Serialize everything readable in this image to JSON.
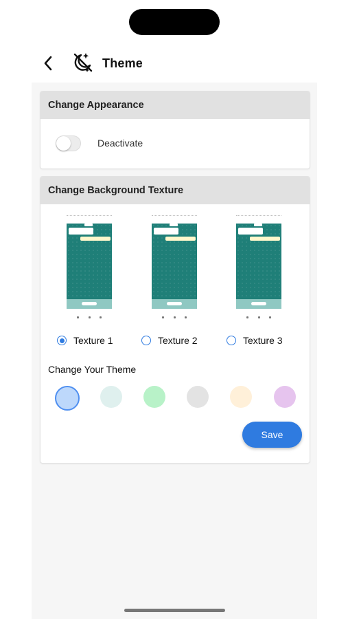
{
  "header": {
    "title": "Theme"
  },
  "appearance": {
    "heading": "Change Appearance",
    "toggle_label": "Deactivate",
    "toggle_on": false
  },
  "background": {
    "heading": "Change Background Texture",
    "textures": [
      {
        "label": "Texture 1",
        "selected": true
      },
      {
        "label": "Texture 2",
        "selected": false
      },
      {
        "label": "Texture 3",
        "selected": false
      }
    ]
  },
  "theme": {
    "heading": "Change Your Theme",
    "swatches": [
      {
        "color": "#bdd8fb",
        "selected": true
      },
      {
        "color": "#dff0ee",
        "selected": false
      },
      {
        "color": "#b8f2c8",
        "selected": false
      },
      {
        "color": "#e3e3e3",
        "selected": false
      },
      {
        "color": "#fff0d9",
        "selected": false
      },
      {
        "color": "#e6c4ee",
        "selected": false
      }
    ],
    "save_label": "Save"
  },
  "colors": {
    "accent": "#2f7be0"
  }
}
